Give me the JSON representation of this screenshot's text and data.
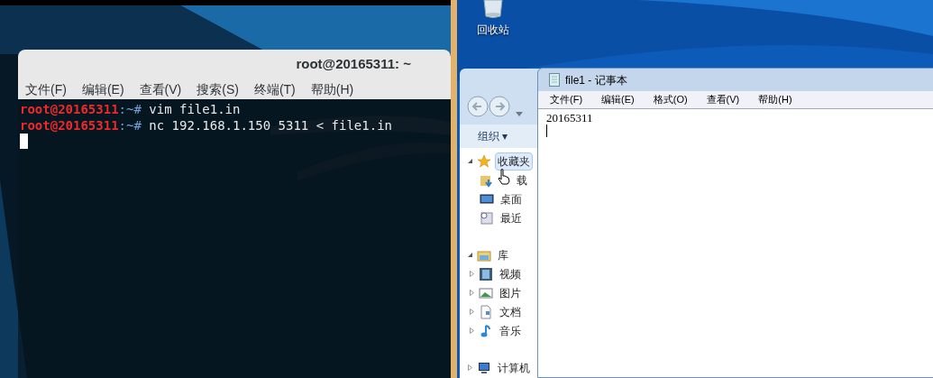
{
  "terminal": {
    "title": "root@20165311: ~",
    "menu": [
      "文件(F)",
      "编辑(E)",
      "查看(V)",
      "搜索(S)",
      "终端(T)",
      "帮助(H)"
    ],
    "lines": [
      {
        "user": "root@20165311",
        "path": ":~# ",
        "command": "vim file1.in"
      },
      {
        "user": "root@20165311",
        "path": ":~# ",
        "command": "nc 192.168.1.150 5311 < file1.in"
      }
    ]
  },
  "desktop": {
    "icons": [
      {
        "label": "回收站"
      }
    ]
  },
  "explorer": {
    "toolbar": [
      "组织 ▾"
    ],
    "tree": [
      {
        "label": "收藏夹",
        "expanded": true,
        "selected": true,
        "children": [
          {
            "label": "载",
            "selected": false
          },
          {
            "label": "桌面",
            "selected": false
          },
          {
            "label": "最近",
            "selected": false
          }
        ]
      },
      {
        "label": "库",
        "expanded": true,
        "selected": false,
        "children": [
          {
            "label": "视频",
            "expanded": false,
            "selected": false
          },
          {
            "label": "图片",
            "expanded": false,
            "selected": false
          },
          {
            "label": "文档",
            "expanded": false,
            "selected": false
          },
          {
            "label": "音乐",
            "expanded": false,
            "selected": false
          }
        ]
      },
      {
        "label": "计算机",
        "expanded": false,
        "selected": false
      }
    ]
  },
  "notepad": {
    "title": "file1 - 记事本",
    "menu": [
      "文件(F)",
      "编辑(E)",
      "格式(O)",
      "查看(V)",
      "帮助(H)"
    ],
    "text": "20165311"
  }
}
